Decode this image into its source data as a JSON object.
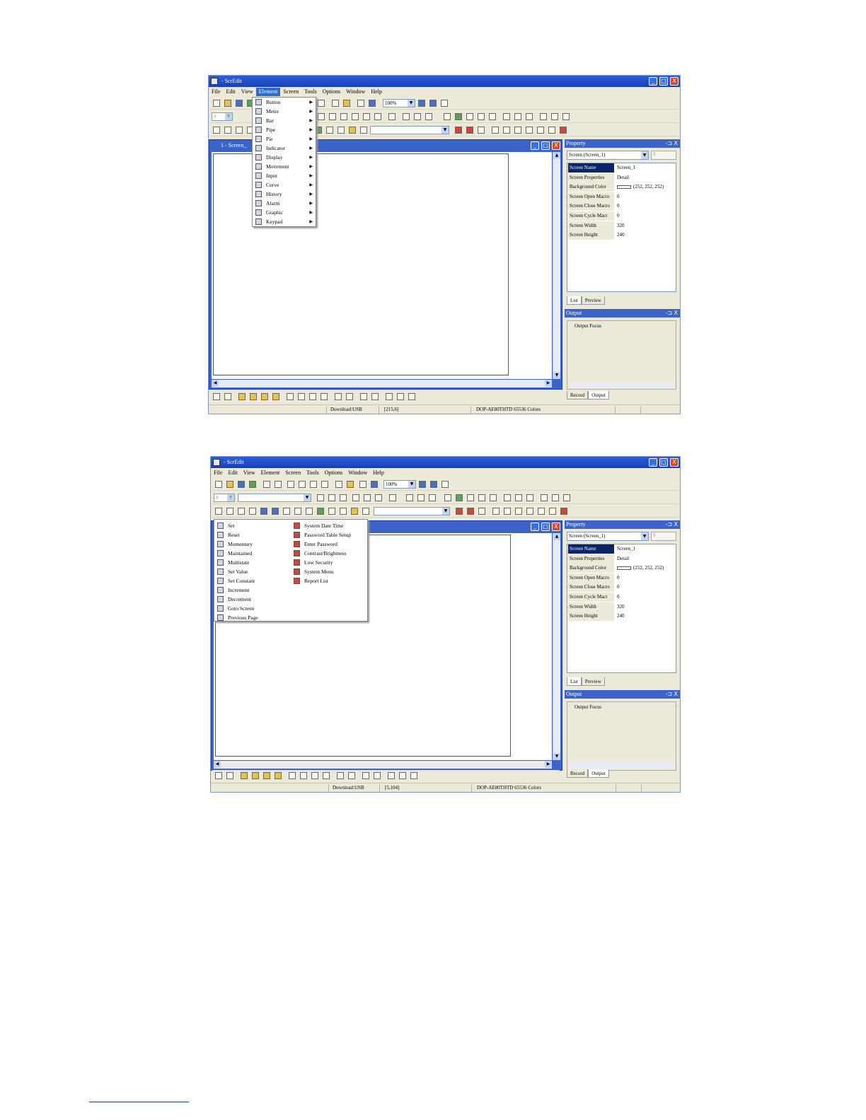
{
  "app": {
    "title": "- ScrEdit",
    "menus": [
      "File",
      "Edit",
      "View",
      "Element",
      "Screen",
      "Tools",
      "Options",
      "Window",
      "Help"
    ],
    "zoom": "100%",
    "font_size_combo": "8",
    "window_buttons": {
      "minimize": "_",
      "maximize": "□",
      "close": "X"
    },
    "arrows": {
      "down": "▼",
      "up": "▲",
      "left": "◀",
      "right": "▶",
      "submenu": "▶"
    }
  },
  "shot1": {
    "doc_title": "1 - Screen_",
    "active_menu": "Element",
    "element_menu": [
      "Button",
      "Meter",
      "Bar",
      "Pipe",
      "Pie",
      "Indicator",
      "Display",
      "Movement",
      "Input",
      "Curve",
      "History",
      "Alarm",
      "Graphic",
      "Keypad"
    ],
    "status": {
      "download": "Download:USB",
      "coords": "[215,6]",
      "model": "DOP-AE80THTD 65536 Colors"
    }
  },
  "shot2": {
    "button_menu_left": [
      "Set",
      "Reset",
      "Momentary",
      "Maintained",
      "Multistate",
      "Set Value",
      "Set Constant",
      "Increment",
      "Decrement",
      "Goto Screen",
      "Previous Page"
    ],
    "button_menu_right": [
      "System Date Time",
      "Password Table Setup",
      "Enter Password",
      "Contrast/Brightness",
      "Low Security",
      "System Menu",
      "Report List"
    ],
    "status": {
      "download": "Download:USB",
      "coords": "[5,104]",
      "model": "DOP-AE80THTD 65536 Colors"
    }
  },
  "property_panel": {
    "title": "Property",
    "pin": "-⊐ X",
    "combo": "Screen (Screen_1)",
    "spin": "0",
    "rows": [
      {
        "key": "Screen Name",
        "value": "Screen_1"
      },
      {
        "key": "Screen Properties",
        "value": "Detail"
      },
      {
        "key": "Background Color",
        "value": "(252, 252, 252)"
      },
      {
        "key": "Screen Open Macro",
        "value": "0"
      },
      {
        "key": "Screen Close Macro",
        "value": "0"
      },
      {
        "key": "Screen Cycle Macr",
        "value": "0"
      },
      {
        "key": "Screen Width",
        "value": "320"
      },
      {
        "key": "Screen Height",
        "value": "240"
      }
    ],
    "tabs": [
      "List",
      "Preview"
    ]
  },
  "output_panel": {
    "title": "Output",
    "item": "Output Focus",
    "tabs": [
      "Record",
      "Output"
    ]
  },
  "colors": {
    "titlebar": "#1c4fce",
    "selection": "#316ac5",
    "panel": "#ece9d8"
  }
}
